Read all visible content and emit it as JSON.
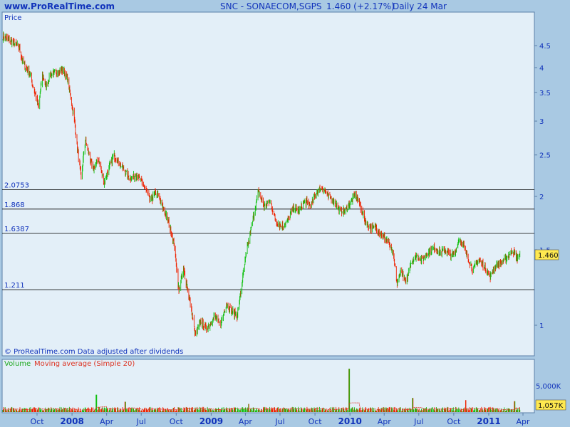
{
  "header": {
    "site": "www.ProRealTime.com",
    "title": "SNC - SONAECOM,SGPS",
    "quote": "1.460 (+2.17%)",
    "period": "Daily  24 Mar"
  },
  "panels": {
    "price_label": "Price",
    "credit": "© ProRealTime.com  Data adjusted after dividends",
    "volume_label": "Volume",
    "volume_ma_label": "Moving average (Simple 20)"
  },
  "colors": {
    "up": "#10c010",
    "down": "#ee2200",
    "panel_bg": "#e3eff8",
    "frame_bg": "#a9c9e3",
    "axis_text": "#1133bb",
    "last_tag": "#ffe94f"
  },
  "chart_data": [
    {
      "type": "candlestick",
      "title": "SNC - SONAECOM,SGPS",
      "y_scale": "log",
      "ylim": [
        0.9,
        5.0
      ],
      "y_ticks": [
        1,
        1.5,
        2,
        2.5,
        3,
        3.5,
        4,
        4.5
      ],
      "x_labels": [
        "Oct",
        "2008",
        "Apr",
        "Jul",
        "Oct",
        "2009",
        "Apr",
        "Jul",
        "Oct",
        "2010",
        "Apr",
        "Jul",
        "Oct",
        "2011",
        "Apr"
      ],
      "x_label_dates": [
        "2007-10-01",
        "2008-01-01",
        "2008-04-01",
        "2008-07-01",
        "2008-10-01",
        "2009-01-01",
        "2009-04-01",
        "2009-07-01",
        "2009-10-01",
        "2010-01-01",
        "2010-04-01",
        "2010-07-01",
        "2010-10-01",
        "2011-01-01",
        "2011-04-01"
      ],
      "horizontal_lines": [
        2.0753,
        1.868,
        1.6387,
        1.211
      ],
      "horizontal_line_labels": [
        "2.0753",
        "1.868",
        "1.6387",
        "1.211"
      ],
      "last_value": 1.46,
      "last_value_label": "1.460",
      "close_path": [
        [
          "2007-07-03",
          4.72
        ],
        [
          "2007-07-20",
          4.65
        ],
        [
          "2007-08-15",
          4.45
        ],
        [
          "2007-08-25",
          4.1
        ],
        [
          "2007-09-10",
          3.9
        ],
        [
          "2007-09-25",
          3.5
        ],
        [
          "2007-10-05",
          3.25
        ],
        [
          "2007-10-15",
          3.85
        ],
        [
          "2007-10-25",
          3.6
        ],
        [
          "2007-11-05",
          3.85
        ],
        [
          "2007-11-20",
          3.9
        ],
        [
          "2007-12-10",
          3.95
        ],
        [
          "2007-12-20",
          3.75
        ],
        [
          "2008-01-05",
          3.1
        ],
        [
          "2008-01-15",
          2.6
        ],
        [
          "2008-01-25",
          2.2
        ],
        [
          "2008-02-05",
          2.7
        ],
        [
          "2008-02-25",
          2.3
        ],
        [
          "2008-03-10",
          2.45
        ],
        [
          "2008-03-25",
          2.15
        ],
        [
          "2008-04-05",
          2.3
        ],
        [
          "2008-04-20",
          2.5
        ],
        [
          "2008-05-10",
          2.35
        ],
        [
          "2008-06-01",
          2.2
        ],
        [
          "2008-06-20",
          2.25
        ],
        [
          "2008-07-10",
          2.1
        ],
        [
          "2008-07-25",
          1.95
        ],
        [
          "2008-08-10",
          2.05
        ],
        [
          "2008-08-25",
          1.9
        ],
        [
          "2008-09-10",
          1.75
        ],
        [
          "2008-09-25",
          1.55
        ],
        [
          "2008-10-08",
          1.2
        ],
        [
          "2008-10-20",
          1.35
        ],
        [
          "2008-11-05",
          1.15
        ],
        [
          "2008-11-20",
          0.95
        ],
        [
          "2008-12-05",
          1.02
        ],
        [
          "2008-12-20",
          0.98
        ],
        [
          "2009-01-10",
          1.05
        ],
        [
          "2009-01-25",
          1.0
        ],
        [
          "2009-02-10",
          1.12
        ],
        [
          "2009-02-25",
          1.08
        ],
        [
          "2009-03-10",
          1.05
        ],
        [
          "2009-03-20",
          1.2
        ],
        [
          "2009-04-05",
          1.5
        ],
        [
          "2009-04-20",
          1.75
        ],
        [
          "2009-05-05",
          2.05
        ],
        [
          "2009-05-20",
          1.9
        ],
        [
          "2009-06-05",
          1.95
        ],
        [
          "2009-06-20",
          1.75
        ],
        [
          "2009-07-05",
          1.7
        ],
        [
          "2009-07-20",
          1.75
        ],
        [
          "2009-08-05",
          1.88
        ],
        [
          "2009-08-20",
          1.85
        ],
        [
          "2009-09-05",
          1.95
        ],
        [
          "2009-09-20",
          1.9
        ],
        [
          "2009-10-05",
          2.05
        ],
        [
          "2009-10-20",
          2.1
        ],
        [
          "2009-11-05",
          2.0
        ],
        [
          "2009-11-20",
          1.95
        ],
        [
          "2009-12-05",
          1.85
        ],
        [
          "2009-12-20",
          1.85
        ],
        [
          "2010-01-05",
          1.95
        ],
        [
          "2010-01-15",
          2.03
        ],
        [
          "2010-01-28",
          1.9
        ],
        [
          "2010-02-10",
          1.75
        ],
        [
          "2010-02-25",
          1.68
        ],
        [
          "2010-03-10",
          1.7
        ],
        [
          "2010-03-25",
          1.62
        ],
        [
          "2010-04-10",
          1.58
        ],
        [
          "2010-04-25",
          1.45
        ],
        [
          "2010-05-05",
          1.25
        ],
        [
          "2010-05-15",
          1.35
        ],
        [
          "2010-05-28",
          1.25
        ],
        [
          "2010-06-10",
          1.4
        ],
        [
          "2010-06-25",
          1.45
        ],
        [
          "2010-07-10",
          1.42
        ],
        [
          "2010-07-25",
          1.48
        ],
        [
          "2010-08-10",
          1.52
        ],
        [
          "2010-08-25",
          1.48
        ],
        [
          "2010-09-10",
          1.5
        ],
        [
          "2010-09-25",
          1.45
        ],
        [
          "2010-10-05",
          1.48
        ],
        [
          "2010-10-15",
          1.6
        ],
        [
          "2010-10-25",
          1.55
        ],
        [
          "2010-11-05",
          1.45
        ],
        [
          "2010-11-20",
          1.35
        ],
        [
          "2010-12-05",
          1.42
        ],
        [
          "2010-12-20",
          1.38
        ],
        [
          "2011-01-05",
          1.3
        ],
        [
          "2011-01-20",
          1.38
        ],
        [
          "2011-02-05",
          1.4
        ],
        [
          "2011-02-20",
          1.45
        ],
        [
          "2011-03-05",
          1.5
        ],
        [
          "2011-03-15",
          1.43
        ],
        [
          "2011-03-24",
          1.46
        ]
      ]
    },
    {
      "type": "bar",
      "title": "Volume",
      "series": [
        {
          "name": "Volume"
        },
        {
          "name": "Moving average (Simple 20)"
        }
      ],
      "y_ticks": [
        5000
      ],
      "y_tick_labels": [
        "5,000K"
      ],
      "last_value_label": "1,057K",
      "volume_spikes_k": [
        [
          "2008-03-05",
          3200
        ],
        [
          "2008-05-20",
          1900
        ],
        [
          "2009-04-10",
          1500
        ],
        [
          "2009-12-30",
          8000
        ],
        [
          "2010-06-15",
          2600
        ],
        [
          "2010-11-01",
          2200
        ],
        [
          "2011-03-10",
          2000
        ]
      ],
      "typical_volume_k": 500
    }
  ]
}
